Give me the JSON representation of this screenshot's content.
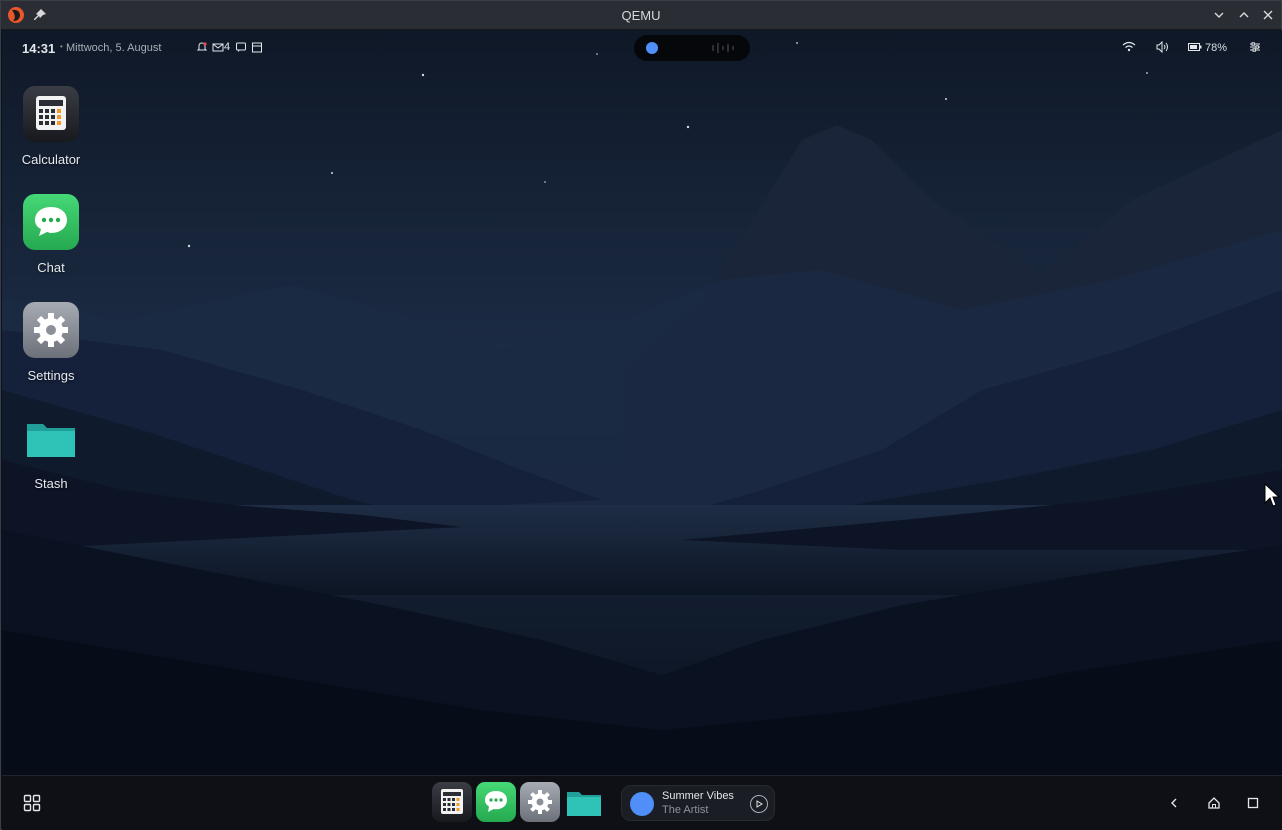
{
  "window": {
    "title": "QEMU",
    "icon": "qemu-logo",
    "controls": [
      "minimize-chevron-down-icon",
      "maximize-chevron-up-icon",
      "close-icon"
    ],
    "pin_icon": "pin-icon"
  },
  "statusbar": {
    "time": "14:31",
    "separator": "•",
    "date": "Mittwoch, 5. August",
    "notifications": [
      {
        "icon": "bell-alert-icon"
      },
      {
        "icon": "mail-icon",
        "count": "4"
      },
      {
        "icon": "chat-bubble-icon"
      },
      {
        "icon": "calendar-icon"
      }
    ],
    "battery": "78%",
    "right_icons": [
      "wifi-icon",
      "volume-icon",
      "battery-icon",
      "quick-settings-icon"
    ]
  },
  "desktop": {
    "icons": [
      {
        "label": "Calculator",
        "icon": "calculator-icon"
      },
      {
        "label": "Chat",
        "icon": "chat-icon"
      },
      {
        "label": "Settings",
        "icon": "settings-gear-icon"
      },
      {
        "label": "Stash",
        "icon": "folder-icon"
      }
    ]
  },
  "taskbar": {
    "launcher_icon": "app-grid-icon",
    "dock": [
      "calculator-icon",
      "chat-icon",
      "settings-gear-icon",
      "folder-icon"
    ],
    "media": {
      "title": "Summer Vibes",
      "artist": "The Artist",
      "play_icon": "play-icon"
    },
    "nav": [
      "back-icon",
      "home-icon",
      "recents-icon"
    ]
  },
  "colors": {
    "accent": "#4f8ff7",
    "chat_green": "#34c463",
    "folder_teal": "#2fc2b6",
    "night_sky": "#1c2c45"
  }
}
